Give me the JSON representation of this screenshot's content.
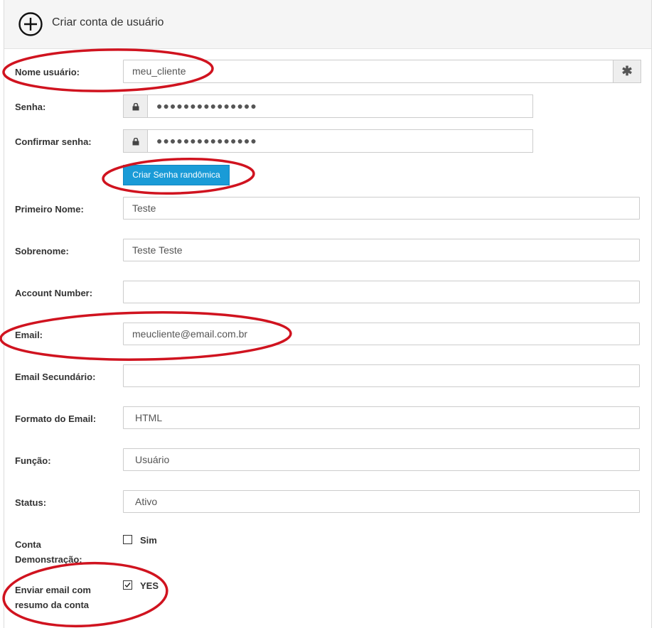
{
  "header": {
    "title": "Criar conta de usuário",
    "icon": "plus-circle-icon"
  },
  "form": {
    "username": {
      "label": "Nome usuário:",
      "value": "meu_cliente",
      "addon_icon": "asterisk-icon",
      "addon_glyph": "✱"
    },
    "password": {
      "label": "Senha:",
      "value": "●●●●●●●●●●●●●●●",
      "addon_icon": "lock-icon"
    },
    "confirm_password": {
      "label": "Confirmar senha:",
      "value": "●●●●●●●●●●●●●●●",
      "addon_icon": "lock-icon"
    },
    "random_button": {
      "label": "Criar Senha randômica",
      "color": "#1a9bd7"
    },
    "first_name": {
      "label": "Primeiro Nome:",
      "value": "Teste"
    },
    "last_name": {
      "label": "Sobrenome:",
      "value": "Teste Teste"
    },
    "account_number": {
      "label": "Account Number:",
      "value": ""
    },
    "email": {
      "label": "Email:",
      "value": "meucliente@email.com.br"
    },
    "secondary_email": {
      "label": "Email Secundário:",
      "value": ""
    },
    "email_format": {
      "label": "Formato do Email:",
      "value": "HTML"
    },
    "role": {
      "label": "Função:",
      "value": "Usuário"
    },
    "status": {
      "label": "Status:",
      "value": "Ativo"
    },
    "demo_account": {
      "label_line1": "Conta",
      "label_line2": "Demonstração:",
      "option": "Sim",
      "checked": false
    },
    "send_summary": {
      "label_line1": "Enviar email com",
      "label_line2": "resumo da conta",
      "option": "YES",
      "checked": true
    }
  },
  "annotation_color": "#d0131f"
}
